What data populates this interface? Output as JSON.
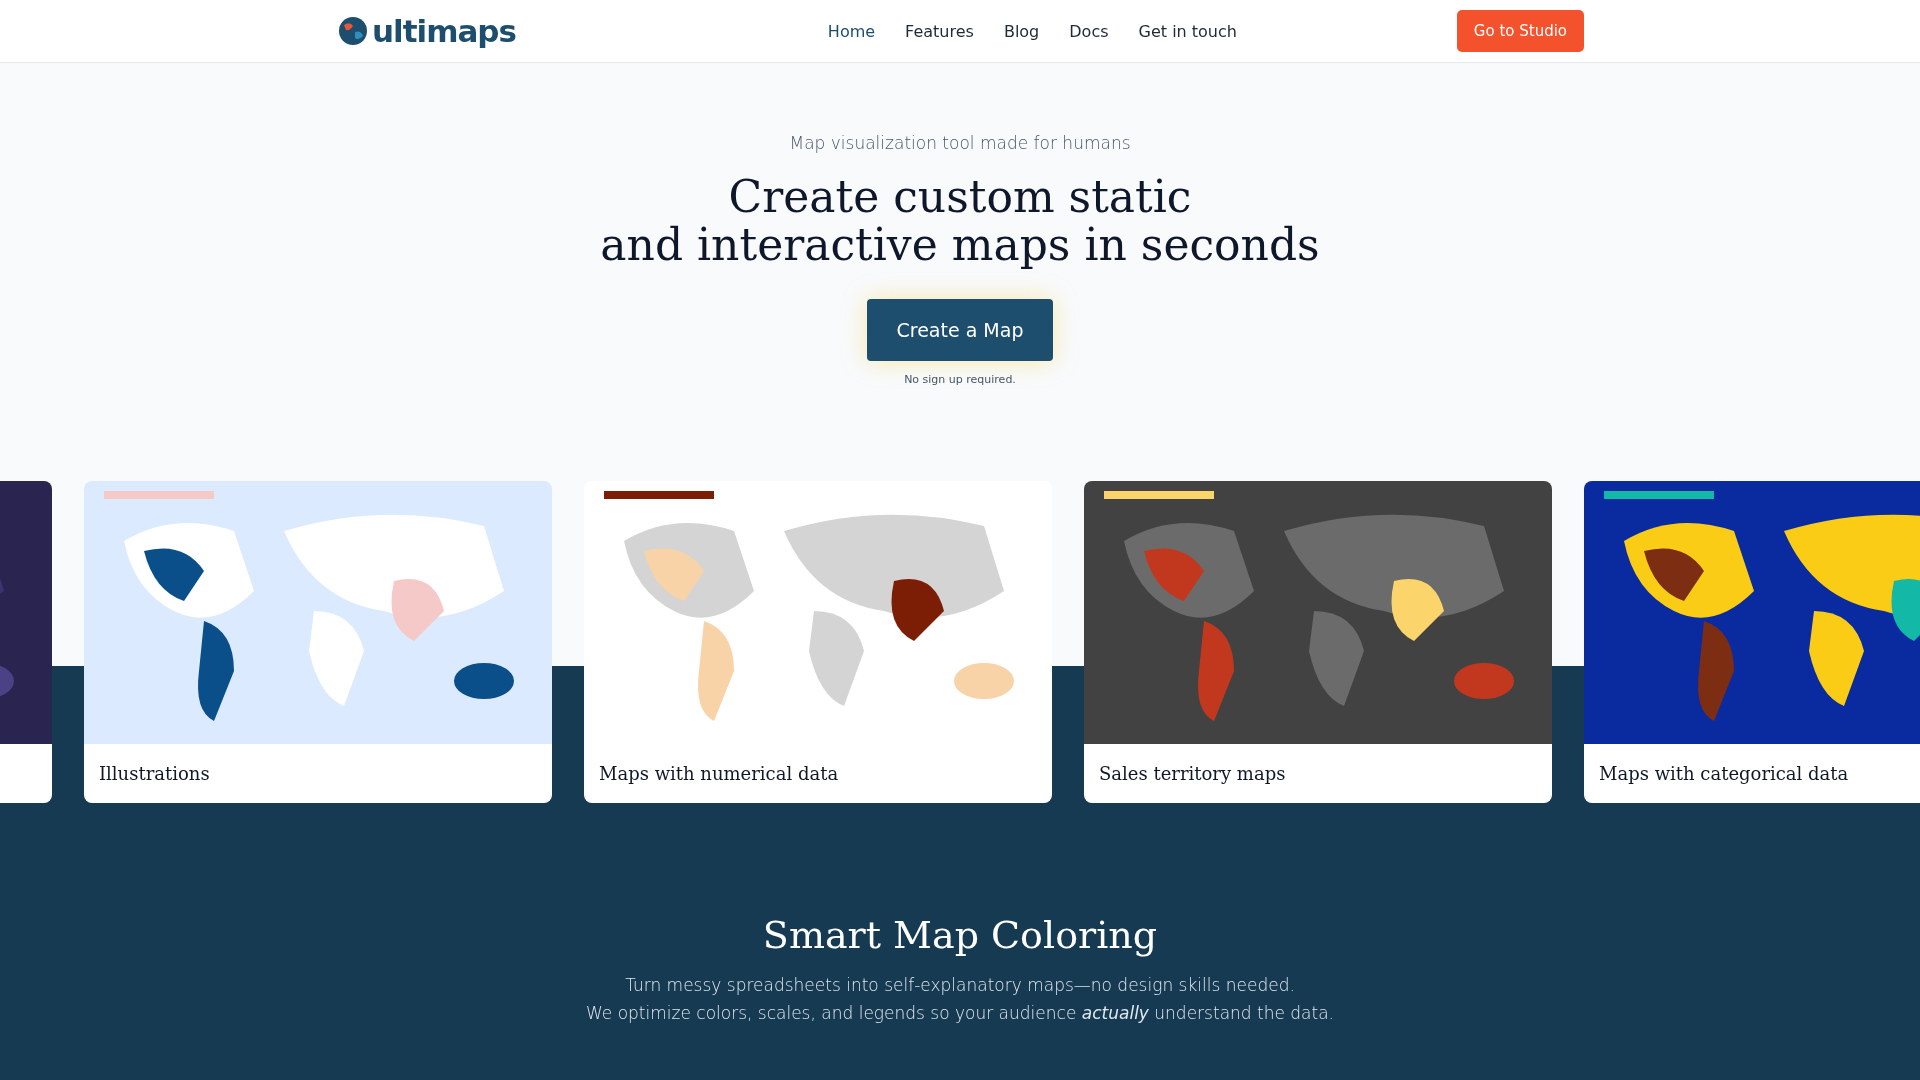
{
  "header": {
    "logo": "ultimaps",
    "nav": [
      {
        "label": "Home",
        "selected": true
      },
      {
        "label": "Features",
        "selected": false
      },
      {
        "label": "Blog",
        "selected": false
      },
      {
        "label": "Docs",
        "selected": false
      },
      {
        "label": "Get in touch",
        "selected": false
      }
    ],
    "cta": "Go to Studio"
  },
  "hero": {
    "tagline": "Map visualization tool made for humans",
    "title_lines": [
      "Create custom static",
      "and interactive maps in seconds"
    ],
    "button": "Create a Map",
    "note": "No sign up required."
  },
  "cards": [
    {
      "kind": "picture"
    },
    {
      "kind": "picture",
      "title": "Illustrations"
    },
    {
      "kind": "picture",
      "title": "Maps with numerical data"
    },
    {
      "kind": "picture",
      "title": "Sales territory maps"
    },
    {
      "kind": "picture",
      "title": "Maps with categorical data"
    }
  ],
  "feature": {
    "title": "Smart Map Coloring",
    "lines": [
      "Turn messy spreadsheets into self-explanatory maps—no design skills needed.",
      "We optimize colors, scales, and legends so your audience *actually* understand the data."
    ]
  }
}
